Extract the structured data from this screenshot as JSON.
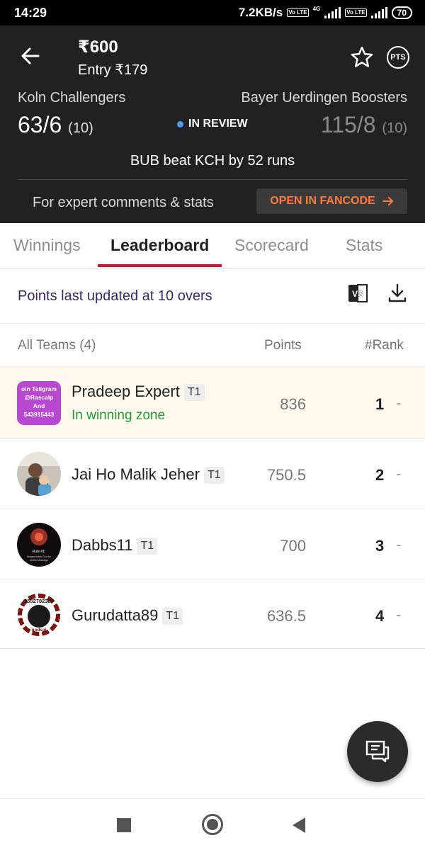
{
  "status_bar": {
    "time": "14:29",
    "speed": "7.2KB/s",
    "lte1": "Vo LTE",
    "net_type": "4G",
    "lte2": "Vo LTE",
    "battery": "70"
  },
  "header": {
    "prize": "₹600",
    "entry": "Entry ₹179",
    "pts_label": "PTS",
    "team_left": {
      "name": "Koln Challengers",
      "score": "63/6",
      "overs": "(10)"
    },
    "team_right": {
      "name": "Bayer Uerdingen Boosters",
      "score": "115/8",
      "overs": "(10)"
    },
    "status": "IN REVIEW",
    "result": "BUB beat KCH by 52 runs",
    "expert_text": "For expert comments & stats",
    "fancode_button": "OPEN IN FANCODE"
  },
  "tabs": [
    {
      "label": "Winnings"
    },
    {
      "label": "Leaderboard"
    },
    {
      "label": "Scorecard"
    },
    {
      "label": "Stats"
    }
  ],
  "info": {
    "updated_text": "Points last updated at 10 overs",
    "vs_label": "VS"
  },
  "columns": {
    "teams": "All Teams (4)",
    "points": "Points",
    "rank": "#Rank"
  },
  "rows": [
    {
      "name": "Pradeep Expert",
      "tag": "T1",
      "status": "In winning zone",
      "points": "836",
      "rank": "1",
      "change": "-",
      "avatar_text": [
        "oin Teligram",
        "@Rascalp",
        "And",
        "543915443"
      ]
    },
    {
      "name": "Jai Ho Malik Jeher",
      "tag": "T1",
      "points": "750.5",
      "rank": "2",
      "change": "-"
    },
    {
      "name": "Dabbs11",
      "tag": "T1",
      "points": "700",
      "rank": "3",
      "change": "-",
      "avatar_text": [
        "Rule #1:",
        "Always thank God for",
        "all the blessings"
      ]
    },
    {
      "name": "Gurudatta89",
      "tag": "T1",
      "points": "636.5",
      "rank": "4",
      "change": "-",
      "avatar_text": [
        "9552782387",
        "godsai"
      ]
    }
  ],
  "colors": {
    "header_bg": "#212121",
    "accent_red": "#d0142b",
    "fancode_orange": "#ff7a3d",
    "winning_green": "#1f9a3a",
    "highlight_row": "#fff8ec"
  }
}
